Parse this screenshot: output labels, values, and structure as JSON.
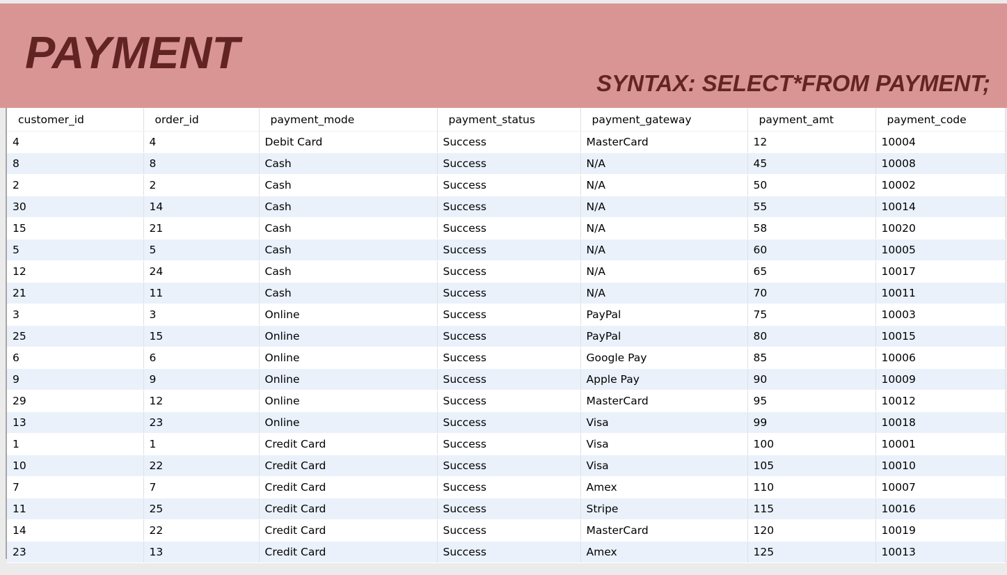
{
  "title": "PAYMENT",
  "syntax": "SYNTAX: SELECT*FROM PAYMENT;",
  "colors": {
    "banner": "#d99594",
    "title": "#622423",
    "alt_row": "#eaf1fb"
  },
  "table": {
    "columns": [
      "customer_id",
      "order_id",
      "payment_mode",
      "payment_status",
      "payment_gateway",
      "payment_amt",
      "payment_code"
    ],
    "rows": [
      [
        "4",
        "4",
        "Debit Card",
        "Success",
        "MasterCard",
        "12",
        "10004"
      ],
      [
        "8",
        "8",
        "Cash",
        "Success",
        "N/A",
        "45",
        "10008"
      ],
      [
        "2",
        "2",
        "Cash",
        "Success",
        "N/A",
        "50",
        "10002"
      ],
      [
        "30",
        "14",
        "Cash",
        "Success",
        "N/A",
        "55",
        "10014"
      ],
      [
        "15",
        "21",
        "Cash",
        "Success",
        "N/A",
        "58",
        "10020"
      ],
      [
        "5",
        "5",
        "Cash",
        "Success",
        "N/A",
        "60",
        "10005"
      ],
      [
        "12",
        "24",
        "Cash",
        "Success",
        "N/A",
        "65",
        "10017"
      ],
      [
        "21",
        "11",
        "Cash",
        "Success",
        "N/A",
        "70",
        "10011"
      ],
      [
        "3",
        "3",
        "Online",
        "Success",
        "PayPal",
        "75",
        "10003"
      ],
      [
        "25",
        "15",
        "Online",
        "Success",
        "PayPal",
        "80",
        "10015"
      ],
      [
        "6",
        "6",
        "Online",
        "Success",
        "Google Pay",
        "85",
        "10006"
      ],
      [
        "9",
        "9",
        "Online",
        "Success",
        "Apple Pay",
        "90",
        "10009"
      ],
      [
        "29",
        "12",
        "Online",
        "Success",
        "MasterCard",
        "95",
        "10012"
      ],
      [
        "13",
        "23",
        "Online",
        "Success",
        "Visa",
        "99",
        "10018"
      ],
      [
        "1",
        "1",
        "Credit Card",
        "Success",
        "Visa",
        "100",
        "10001"
      ],
      [
        "10",
        "22",
        "Credit Card",
        "Success",
        "Visa",
        "105",
        "10010"
      ],
      [
        "7",
        "7",
        "Credit Card",
        "Success",
        "Amex",
        "110",
        "10007"
      ],
      [
        "11",
        "25",
        "Credit Card",
        "Success",
        "Stripe",
        "115",
        "10016"
      ],
      [
        "14",
        "22",
        "Credit Card",
        "Success",
        "MasterCard",
        "120",
        "10019"
      ],
      [
        "23",
        "13",
        "Credit Card",
        "Success",
        "Amex",
        "125",
        "10013"
      ]
    ]
  }
}
